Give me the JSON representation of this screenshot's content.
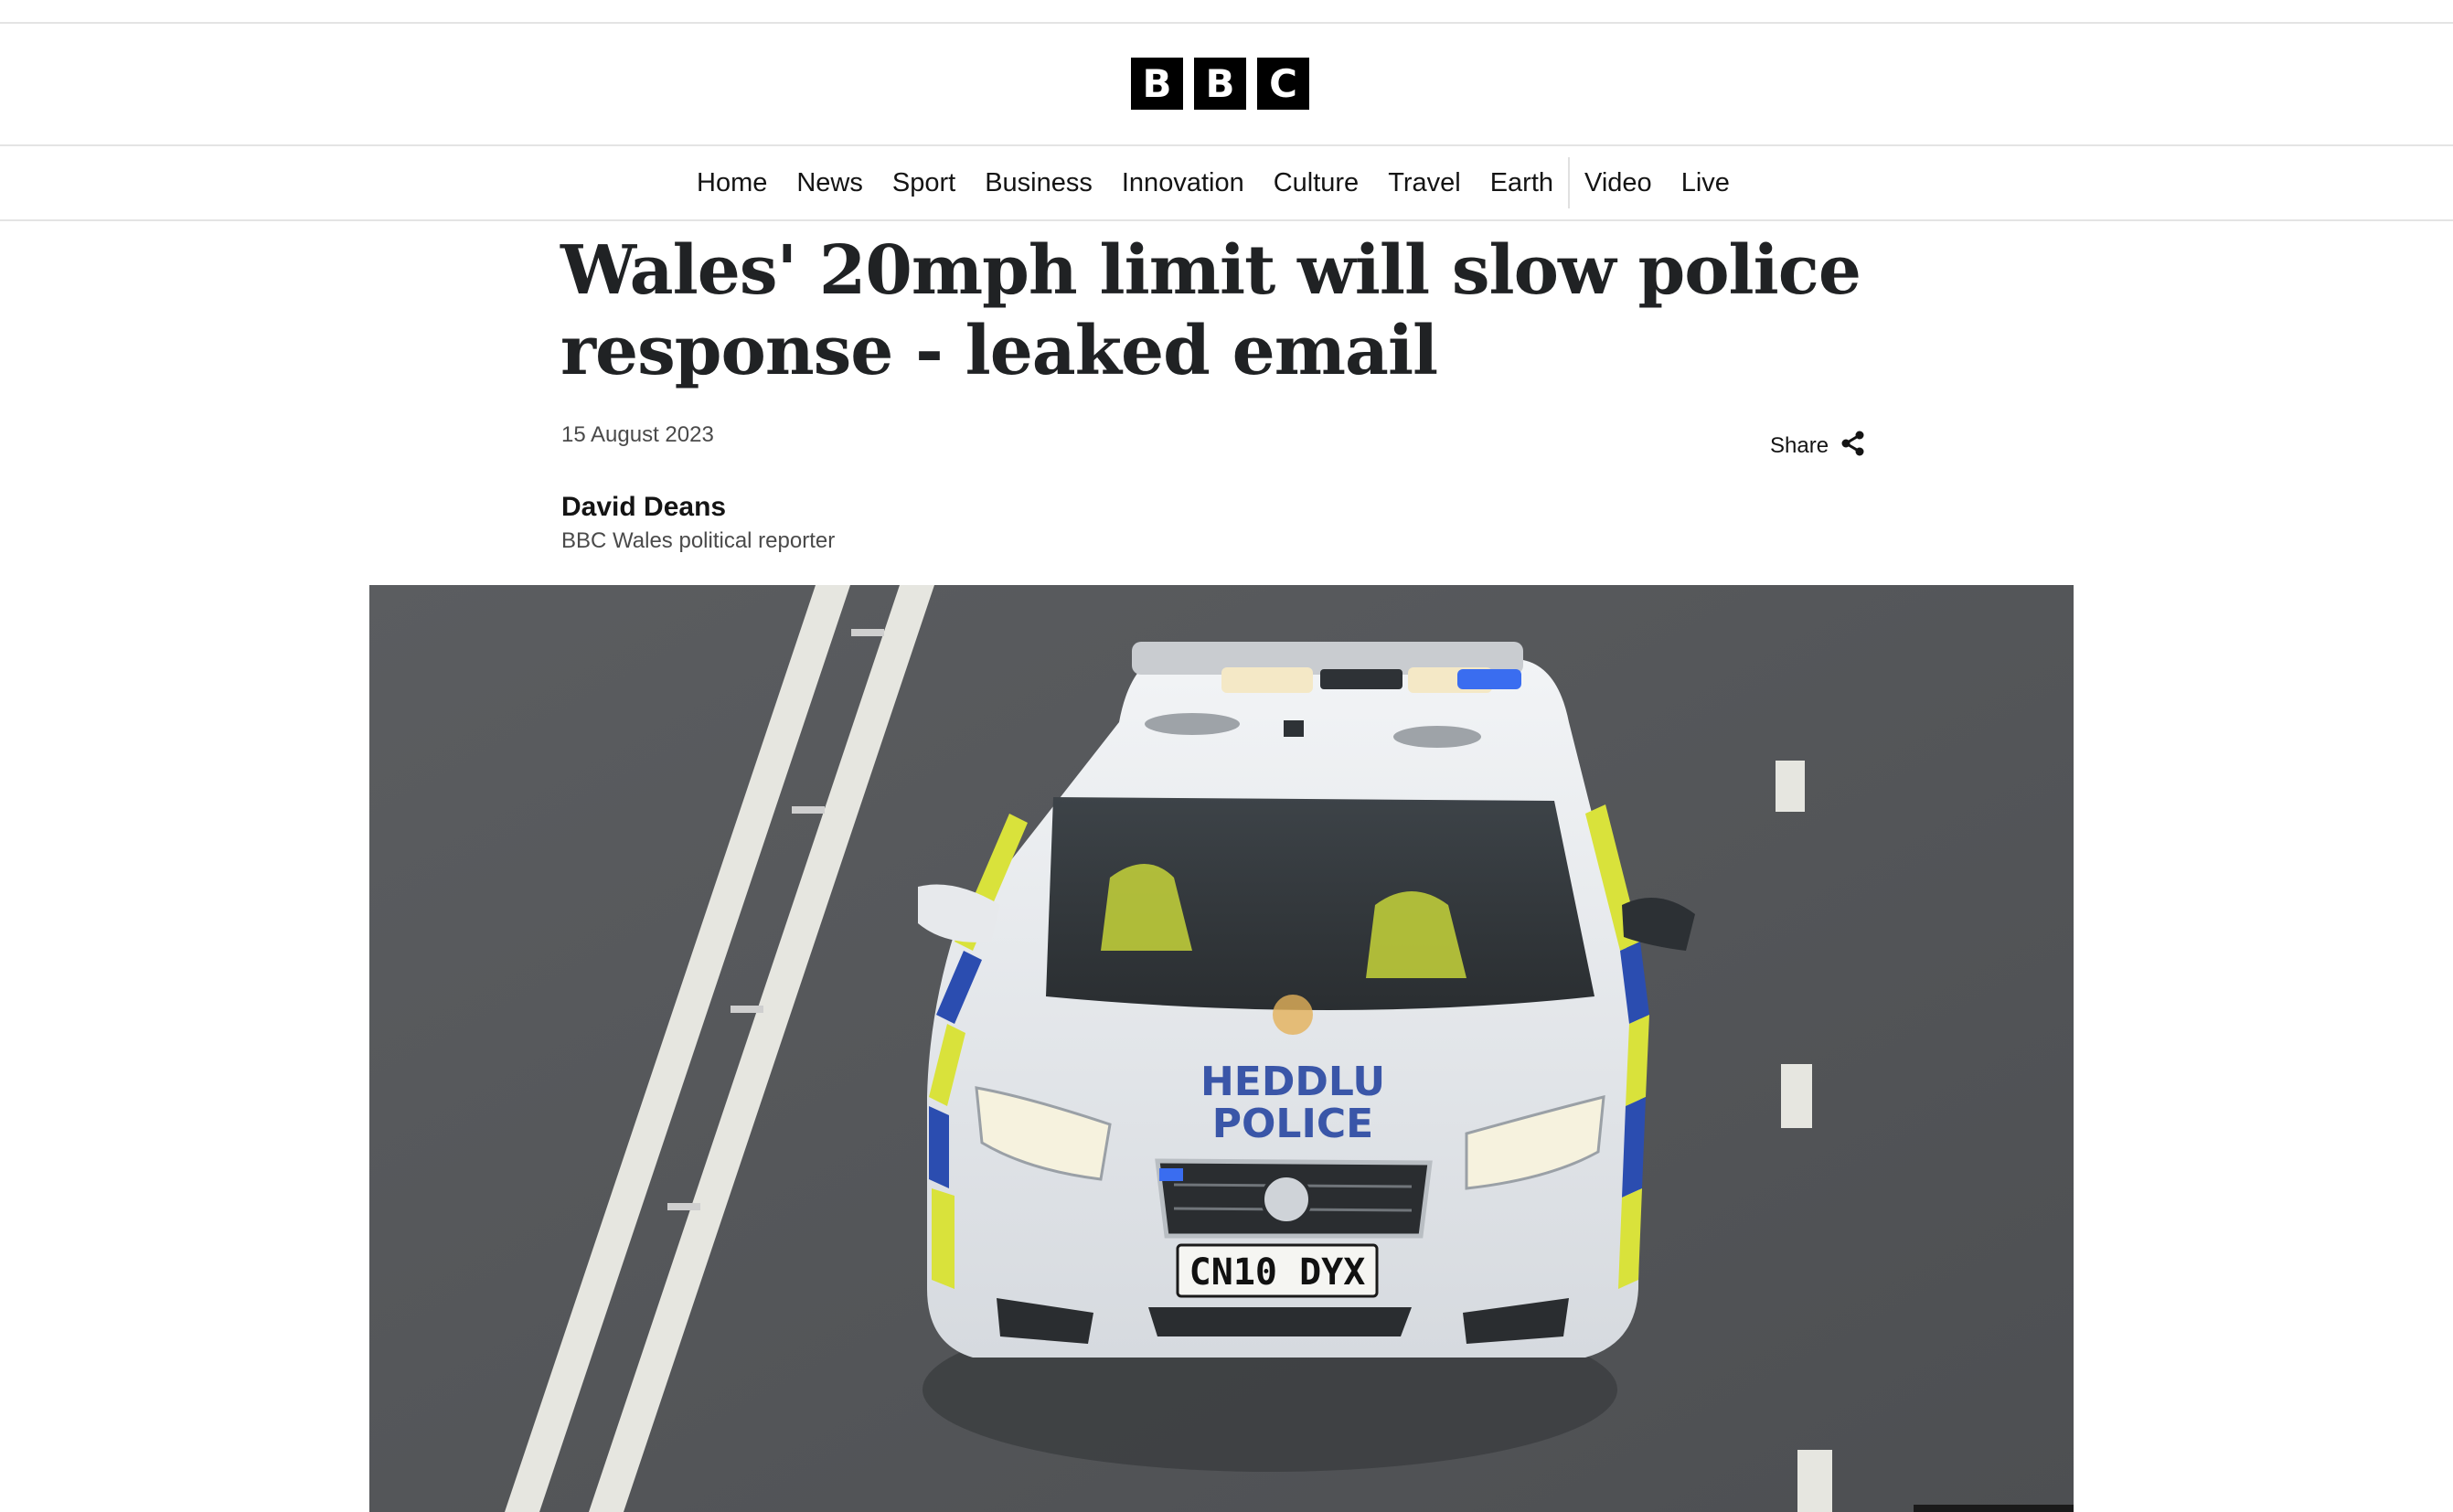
{
  "header": {
    "logo_letters": [
      "B",
      "B",
      "C"
    ]
  },
  "nav": {
    "items": [
      "Home",
      "News",
      "Sport",
      "Business",
      "Innovation",
      "Culture",
      "Travel",
      "Earth",
      "Video",
      "Live"
    ]
  },
  "article": {
    "headline": "Wales' 20mph limit will slow police response - leaked email",
    "date": "15 August 2023",
    "share_label": "Share",
    "share_icon": "share-icon",
    "author_name": "David Deans",
    "author_role": "BBC Wales political reporter"
  },
  "hero_image": {
    "subject": "police-car-photo",
    "bonnet_text_1": "HEDDLU",
    "bonnet_text_2": "POLICE",
    "plate": "CN10 DYX"
  }
}
